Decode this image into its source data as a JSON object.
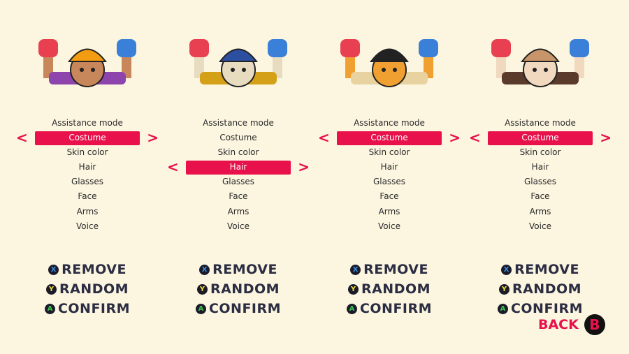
{
  "menu_items": [
    "Assistance mode",
    "Costume",
    "Skin color",
    "Hair",
    "Glasses",
    "Face",
    "Arms",
    "Voice"
  ],
  "players": [
    {
      "selected": 1,
      "skin": "#c8875a",
      "hat": "#f39c12",
      "body": "#8e44ad"
    },
    {
      "selected": 3,
      "skin": "#e8dcc0",
      "hat": "#2d4fa0",
      "body": "#d4a017"
    },
    {
      "selected": 1,
      "skin": "#f0a030",
      "hat": "#222222",
      "body": "#e8d3a0"
    },
    {
      "selected": 1,
      "skin": "#f1d9c0",
      "hat": "#c8956a",
      "body": "#5a3a2a"
    }
  ],
  "arrows": {
    "left": "<",
    "right": ">"
  },
  "actions": [
    {
      "key": "X",
      "label": "REMOVE",
      "color": "#3a8fe0"
    },
    {
      "key": "Y",
      "label": "RANDOM",
      "color": "#f5e23a"
    },
    {
      "key": "A",
      "label": "CONFIRM",
      "color": "#3bc24a"
    }
  ],
  "back": {
    "label": "BACK",
    "key": "B"
  },
  "colors": {
    "accent": "#e8114b",
    "background": "#fcf5e0",
    "glove_left": "#e84050",
    "glove_right": "#3a7fd8"
  }
}
